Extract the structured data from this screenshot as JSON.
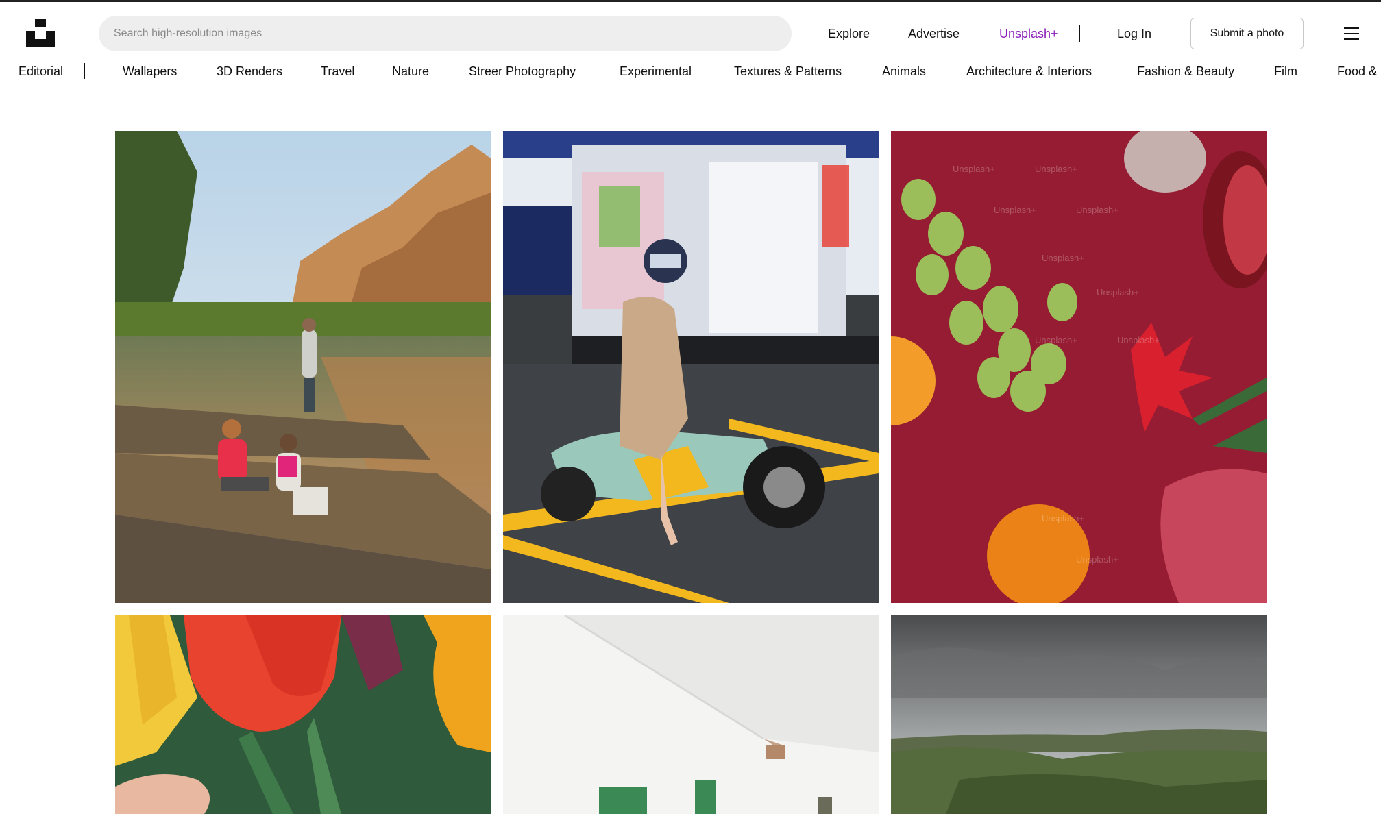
{
  "header": {
    "search_placeholder": "Search high-resolution images",
    "nav": {
      "explore": "Explore",
      "advertise": "Advertise",
      "unsplash_plus": "Unsplash+",
      "login": "Log In"
    },
    "submit_label": "Submit a photo",
    "colors": {
      "unsplash_plus": "#8b1fb8",
      "search_bg": "#eeeeee"
    }
  },
  "categories": {
    "featured": "Editorial",
    "items": [
      "Wallapers",
      "3D Renders",
      "Travel",
      "Nature",
      "Streer Photography",
      "Experimental",
      "Textures & Patterns",
      "Animals",
      "Architecture & Interiors",
      "Fashion & Beauty",
      "Film",
      "Food &"
    ]
  },
  "watermark": "Unsplash+",
  "icons": [
    "unsplash-logo-icon",
    "hamburger-menu-icon"
  ]
}
